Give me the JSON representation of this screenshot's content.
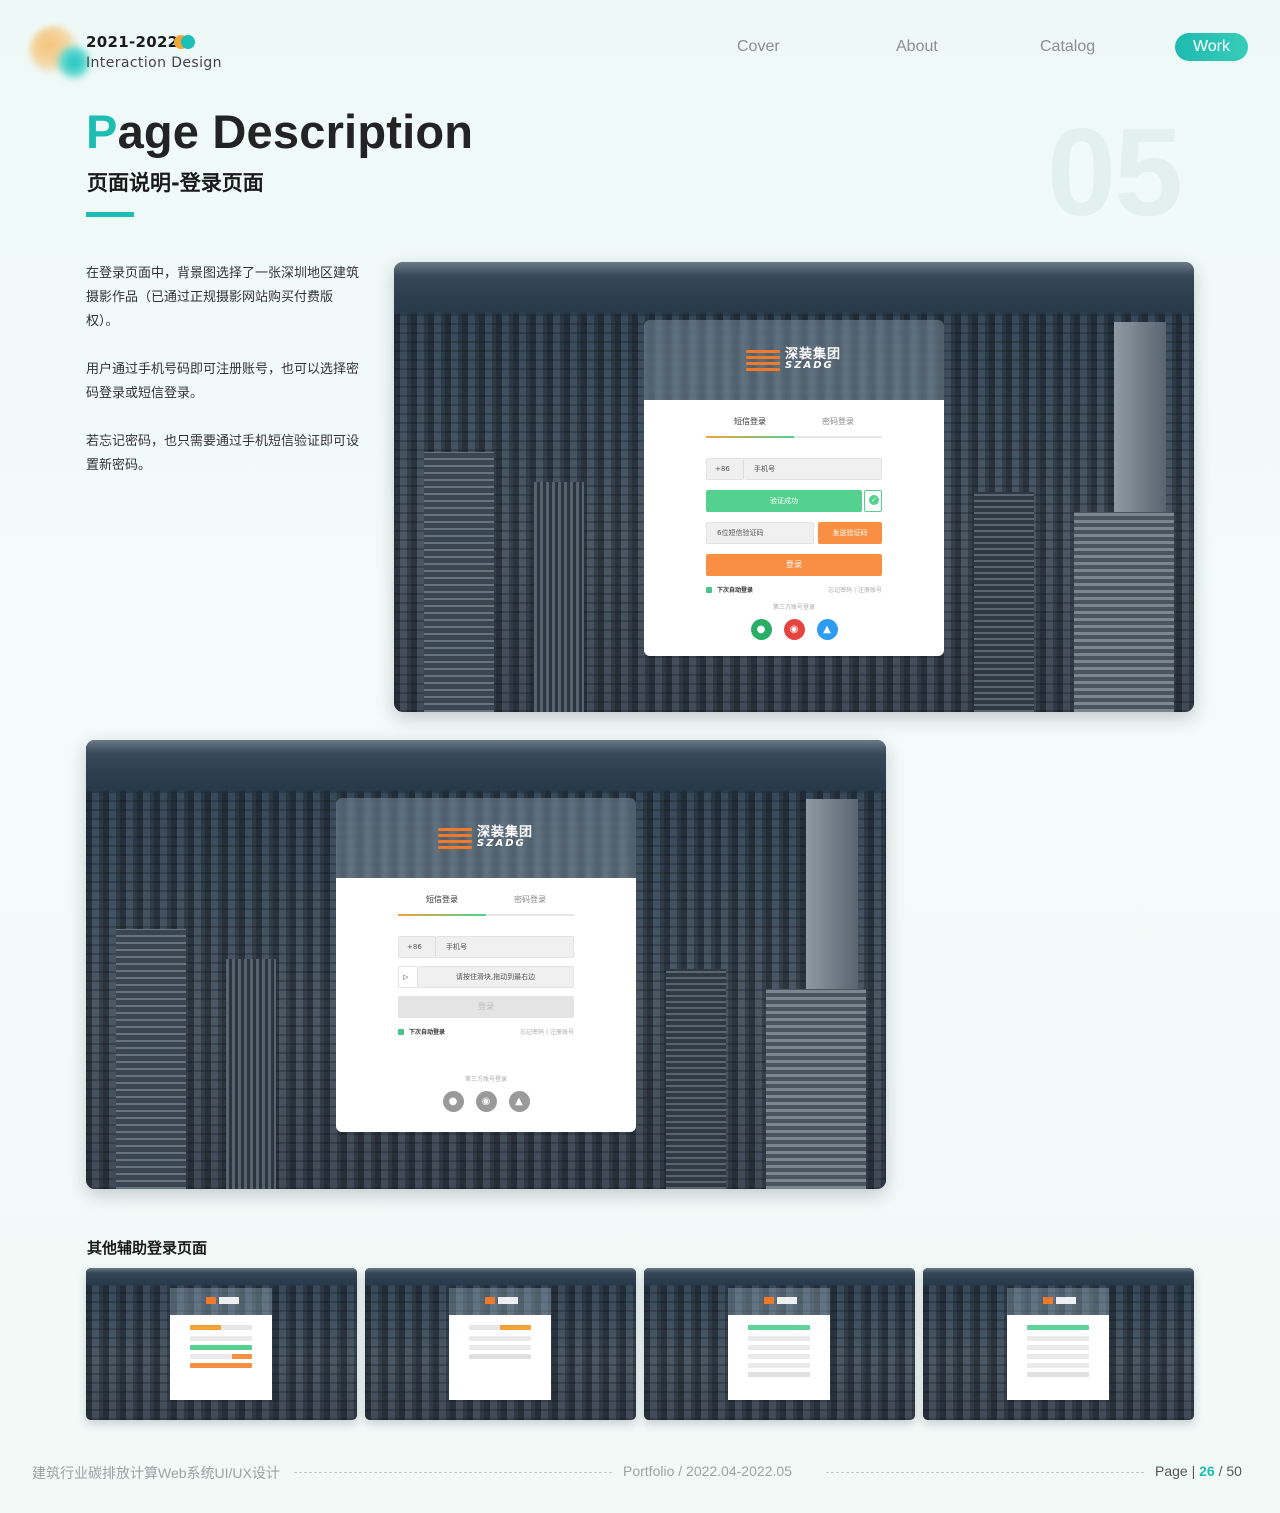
{
  "header": {
    "year": "2021-2022",
    "subtitle": "Interaction Design",
    "nav": {
      "cover": "Cover",
      "about": "About",
      "catalog": "Catalog",
      "work": "Work"
    }
  },
  "title": {
    "first_letter": "P",
    "rest": "age Description",
    "cn": "页面说明-登录页面",
    "section_number": "05"
  },
  "description": [
    "在登录页面中，背景图选择了一张深圳地区建筑摄影作品（已通过正规摄影网站购买付费版权）。",
    "用户通过手机号码即可注册账号，也可以选择密码登录或短信登录。",
    "若忘记密码，也只需要通过手机短信验证即可设置新密码。"
  ],
  "login_a": {
    "brand_cn": "深装集团",
    "brand_en": "SZADG",
    "tab_sms": "短信登录",
    "tab_pwd": "密码登录",
    "country_code": "+86",
    "phone_placeholder": "手机号",
    "verify_success": "验证成功",
    "code_placeholder": "6位短信验证码",
    "send_code": "发送验证码",
    "login": "登录",
    "auto_login": "下次自动登录",
    "forgot": "忘记密码",
    "register": "注册账号",
    "third_party": "第三方账号登录"
  },
  "login_b": {
    "brand_cn": "深装集团",
    "brand_en": "SZADG",
    "tab_sms": "短信登录",
    "tab_pwd": "密码登录",
    "country_code": "+86",
    "phone_placeholder": "手机号",
    "slider_hint": "请按住滑块,拖动到最右边",
    "login": "登录",
    "auto_login": "下次自动登录",
    "forgot": "忘记密码",
    "register": "注册账号",
    "third_party": "第三方账号登录"
  },
  "other_heading": "其他辅助登录页面",
  "footer": {
    "project": "建筑行业碳排放计算Web系统UI/UX设计",
    "portfolio": "Portfolio / 2022.04-2022.05",
    "page_label": "Page",
    "page_current": "26",
    "page_total": "/ 50"
  },
  "colors": {
    "accent": "#1dbdb3",
    "orange": "#f98f43",
    "green": "#55d18f",
    "wechat": "#2aae67",
    "weibo": "#e6453f",
    "qq": "#2d9cf0"
  }
}
